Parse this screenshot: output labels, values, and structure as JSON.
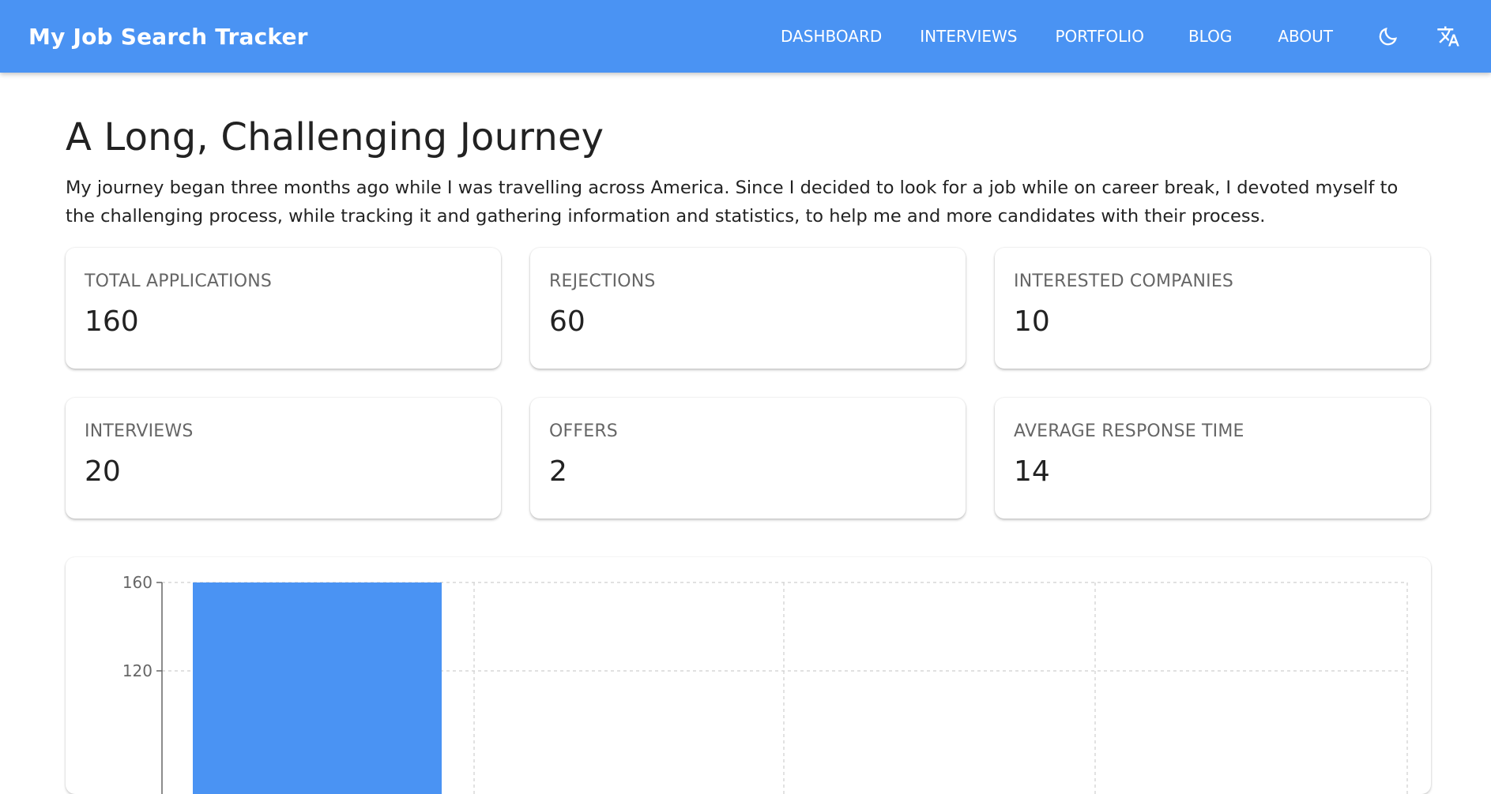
{
  "header": {
    "title": "My Job Search Tracker",
    "nav": [
      "DASHBOARD",
      "INTERVIEWS",
      "PORTFOLIO",
      "BLOG",
      "ABOUT"
    ],
    "icons": [
      "dark-mode-moon-icon",
      "translate-icon"
    ]
  },
  "page": {
    "title": "A Long, Challenging Journey",
    "intro": "My journey began three months ago while I was travelling across America. Since I decided to look for a job while on career break, I devoted myself to the challenging process, while tracking it and gathering information and statistics, to help me and more candidates with their process."
  },
  "stats": [
    {
      "label": "TOTAL APPLICATIONS",
      "value": "160"
    },
    {
      "label": "REJECTIONS",
      "value": "60"
    },
    {
      "label": "INTERESTED COMPANIES",
      "value": "10"
    },
    {
      "label": "INTERVIEWS",
      "value": "20"
    },
    {
      "label": "OFFERS",
      "value": "2"
    },
    {
      "label": "AVERAGE RESPONSE TIME",
      "value": "14"
    }
  ],
  "colors": {
    "appbar": "#4a93f3",
    "bar": "#4a93f3"
  },
  "chart_data": {
    "type": "bar",
    "title": "",
    "xlabel": "",
    "ylabel": "",
    "y_ticks": [
      120,
      160
    ],
    "ylim_visible": [
      80,
      160
    ],
    "values": [
      160
    ],
    "grid": true
  }
}
